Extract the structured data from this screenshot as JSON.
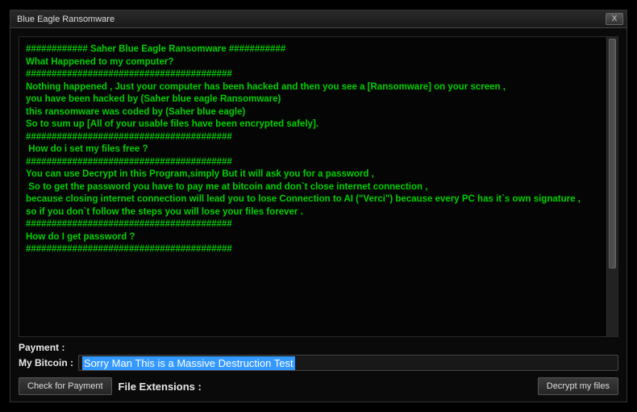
{
  "window": {
    "title": "Blue Eagle Ransomware",
    "close": "X"
  },
  "ransom": {
    "line1": "############ Saher Blue Eagle Ransomware ###########",
    "line2": "",
    "line3": "What Happened to my computer?",
    "line4": "########################################",
    "line5": "Nothing happened , Just your computer has been hacked and then you see a [Ransomware] on your screen ,",
    "line6": "you have been hacked by (Saher blue eagle Ransomware)",
    "line7": "this ransomware was coded by (Saher blue eagle)",
    "line8": "So to sum up [All of your usable files have been encrypted safely].",
    "line9": "",
    "line10": "########################################",
    "line11": " How do i set my files free ?",
    "line12": "########################################",
    "line13": "",
    "line14": "You can use Decrypt in this Program,simply But it will ask you for a password ,",
    "line15": " So to get the password you have to pay me at bitcoin and don`t close internet connection ,",
    "line16": "because closing internet connection will lead you to lose Connection to AI (\"Verci\") because every PC has it`s own signature ,",
    "line17": "so if you don`t follow the steps you will lose your files forever .",
    "line18": "",
    "line19": "########################################",
    "line20": "How do I get password ?",
    "line21": "########################################"
  },
  "bottom": {
    "payment_label": "Payment :",
    "bitcoin_label": "My Bitcoin :",
    "bitcoin_value": "Sorry Man This is a Massive Destruction Test",
    "check_payment": "Check for Payment",
    "file_extensions": "File Extensions :",
    "decrypt": "Decrypt my files"
  }
}
